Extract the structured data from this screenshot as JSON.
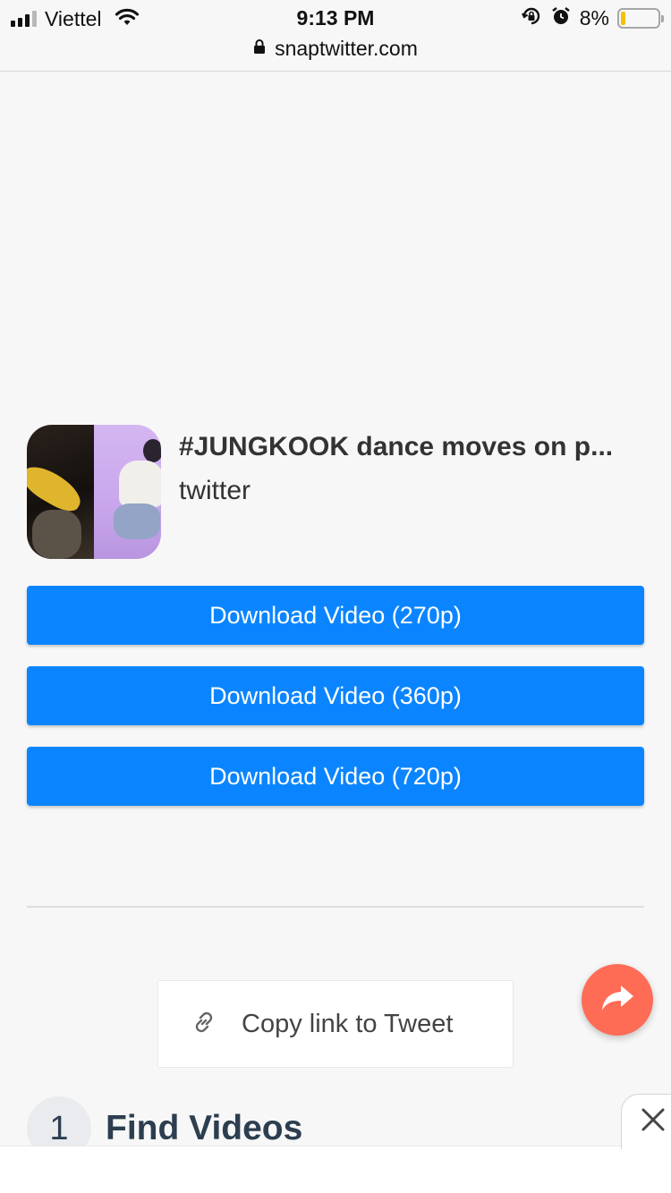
{
  "status_bar": {
    "carrier": "Viettel",
    "time": "9:13 PM",
    "battery_percent": "8%",
    "battery_level": 0.08,
    "url": "snaptwitter.com"
  },
  "video": {
    "title": "#JUNGKOOK dance moves on p...",
    "source": "twitter"
  },
  "download_buttons": [
    {
      "label": "Download Video (270p)"
    },
    {
      "label": "Download Video (360p)"
    },
    {
      "label": "Download Video (720p)"
    }
  ],
  "copy_link": {
    "label": "Copy link to Tweet"
  },
  "step": {
    "number": "1",
    "title": "Find Videos"
  },
  "colors": {
    "primary": "#0b85ff",
    "share_fab": "#ff6c56"
  },
  "icons": [
    "signal-icon",
    "wifi-icon",
    "lock-icon",
    "rotation-lock-icon",
    "alarm-icon",
    "battery-icon",
    "link-icon",
    "share-icon",
    "close-icon"
  ]
}
